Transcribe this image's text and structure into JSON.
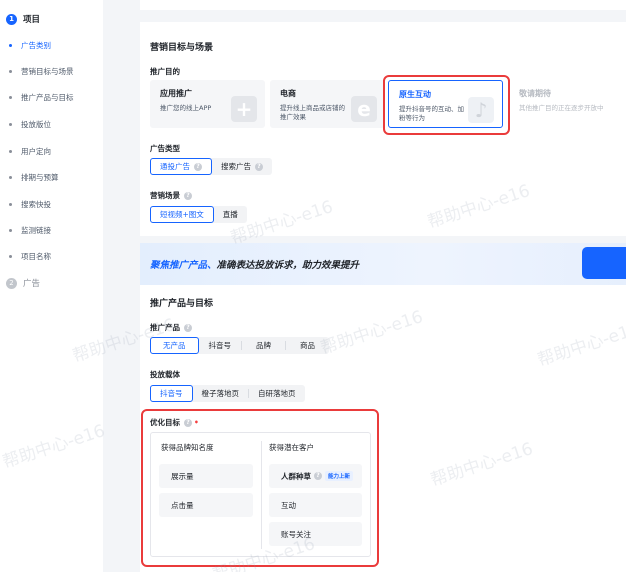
{
  "sidebar": {
    "step1": {
      "num": "1",
      "label": "项目"
    },
    "items": [
      {
        "label": "广告类别"
      },
      {
        "label": "营销目标与场景"
      },
      {
        "label": "推广产品与目标"
      },
      {
        "label": "投放版位"
      },
      {
        "label": "用户定向"
      },
      {
        "label": "排期与预算"
      },
      {
        "label": "搜索快投"
      },
      {
        "label": "监测链接"
      },
      {
        "label": "项目名称"
      }
    ],
    "step2": {
      "num": "2",
      "label": "广告"
    }
  },
  "marketing": {
    "title": "营销目标与场景",
    "purpose_label": "推广目的",
    "goals": [
      {
        "title": "应用推广",
        "desc": "推广您的线上APP",
        "deco": "+"
      },
      {
        "title": "电商",
        "desc": "提升线上商品或店铺的推广效果",
        "deco": "e"
      },
      {
        "title": "原生互动",
        "desc": "提升抖音号的互动、加粉等行为",
        "deco": "♪"
      },
      {
        "title": "敬请期待",
        "desc": "其他推广目的正在逐步开放中",
        "deco": ""
      }
    ],
    "ad_type_label": "广告类型",
    "ad_type_help": "?",
    "ad_types": [
      "通投广告",
      "搜索广告"
    ],
    "scene_label": "营销场景",
    "scene_help": "?",
    "scenes": [
      "短视频+图文",
      "直播"
    ]
  },
  "banner": {
    "highlight": "聚焦推广产品、",
    "text": "准确表达投放诉求，助力效果提升"
  },
  "product": {
    "title": "推广产品与目标",
    "product_label": "推广产品",
    "product_help": "?",
    "products": [
      "无产品",
      "抖音号",
      "品牌",
      "商品"
    ],
    "carrier_label": "投放载体",
    "carriers": [
      "抖音号",
      "橙子落地页",
      "自研落地页"
    ],
    "optimize_label": "优化目标",
    "optimize_required": "•",
    "col1_title": "获得品牌知名度",
    "col1_items": [
      "展示量",
      "点击量"
    ],
    "col2_title": "获得潜在客户",
    "col2_items": [
      "人群种草",
      "互动",
      "账号关注"
    ],
    "col2_badge": "能力上新",
    "col2_help": "?"
  },
  "watermark": "帮助中心-e16",
  "colors": {
    "accent": "#1664ff",
    "highlight_border": "#ea3b3b"
  }
}
